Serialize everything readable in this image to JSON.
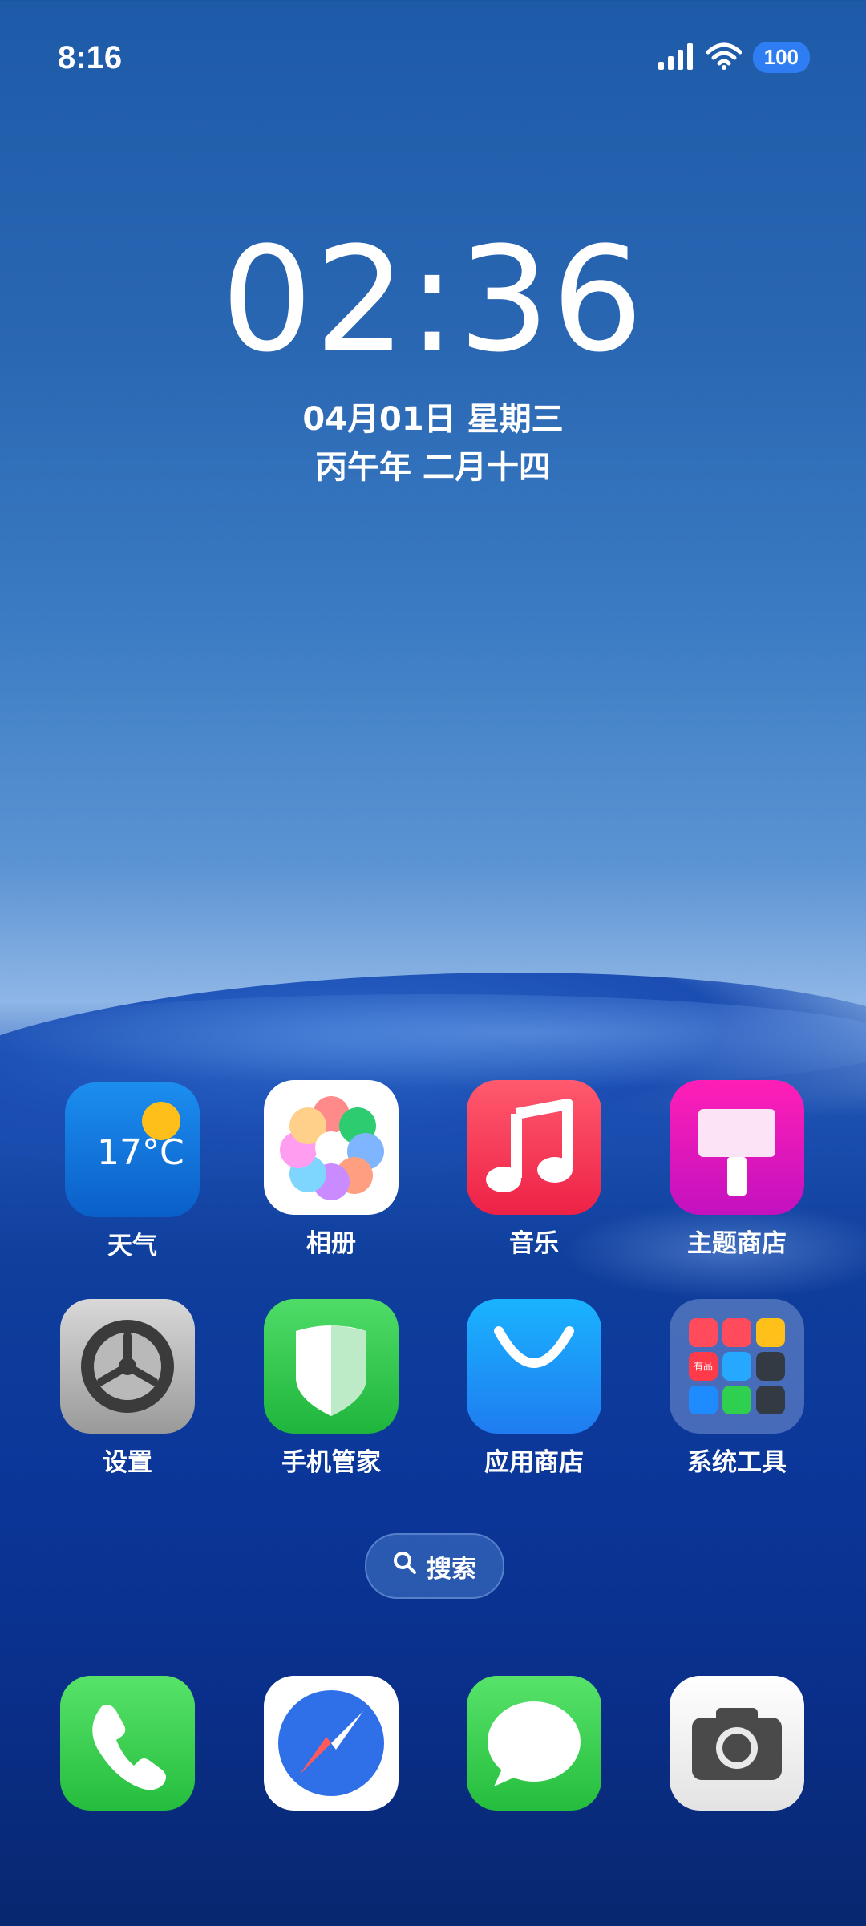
{
  "status_bar": {
    "time": "8:16",
    "battery": "100",
    "signal_icon": "signal-bars-icon",
    "wifi_icon": "wifi-icon"
  },
  "lock_clock": {
    "time": "02:36",
    "date": "04月01日 星期三",
    "lunar": "丙午年 二月十四"
  },
  "apps": [
    {
      "label": "天气",
      "icon": "weather-icon",
      "temp": "17°C"
    },
    {
      "label": "相册",
      "icon": "gallery-icon"
    },
    {
      "label": "音乐",
      "icon": "music-icon"
    },
    {
      "label": "主题商店",
      "icon": "theme-store-icon"
    },
    {
      "label": "设置",
      "icon": "settings-gear-icon"
    },
    {
      "label": "手机管家",
      "icon": "shield-icon"
    },
    {
      "label": "应用商店",
      "icon": "app-store-icon"
    },
    {
      "label": "系统工具",
      "icon": "folder-icon",
      "folder_badge": "有品"
    }
  ],
  "search": {
    "label": "搜索",
    "icon": "search-icon"
  },
  "dock": [
    {
      "icon": "phone-icon"
    },
    {
      "icon": "compass-browser-icon"
    },
    {
      "icon": "messages-icon"
    },
    {
      "icon": "camera-icon"
    }
  ],
  "colors": {
    "battery_bg": "#2f7df2",
    "weather_sun": "#ffbf1a",
    "music": "#ee2146",
    "theme": "#c311c0",
    "green": "#25bd3d",
    "store_blue": "#1f7cf0"
  }
}
